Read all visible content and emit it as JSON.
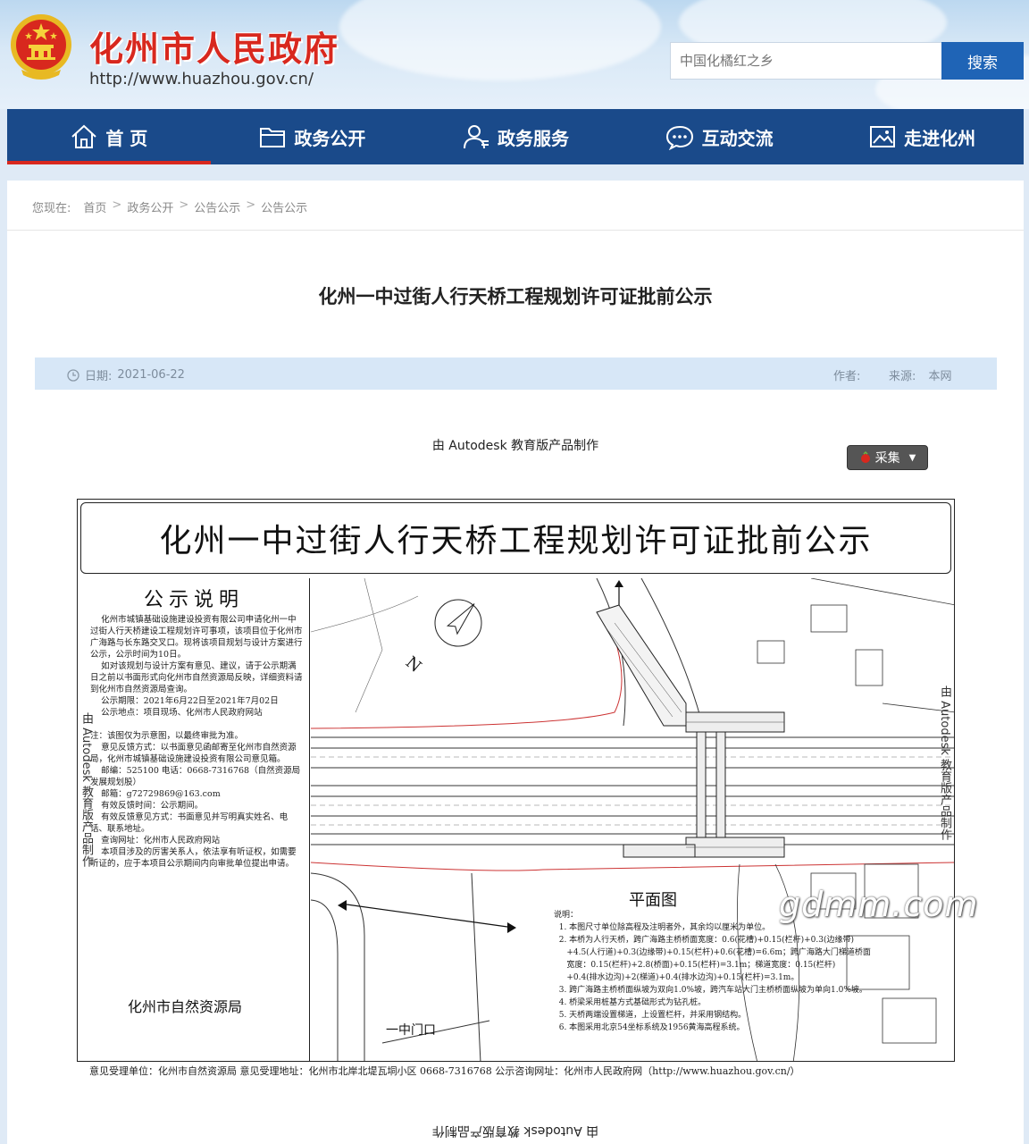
{
  "header": {
    "site_name": "化州市人民政府",
    "site_url": "http://www.huazhou.gov.cn/",
    "search_placeholder": "中国化橘红之乡",
    "search_button": "搜索"
  },
  "nav": {
    "items": [
      {
        "label": "首 页",
        "icon": "home-icon",
        "active": true
      },
      {
        "label": "政务公开",
        "icon": "folder-icon"
      },
      {
        "label": "政务服务",
        "icon": "user-service-icon"
      },
      {
        "label": "互动交流",
        "icon": "chat-icon"
      },
      {
        "label": "走进化州",
        "icon": "picture-icon"
      }
    ]
  },
  "breadcrumb": {
    "prefix": "您现在:",
    "items": [
      "首页",
      "政务公开",
      "公告公示",
      "公告公示"
    ]
  },
  "article": {
    "title": "化州一中过街人行天桥工程规划许可证批前公示",
    "date_label": "日期:",
    "date": "2021-06-22",
    "author_label": "作者:",
    "source_label": "来源:",
    "source": "本网",
    "autodesk_note": "由 Autodesk 教育版产品制作",
    "collect_button": "采集"
  },
  "drawing": {
    "title": "化州一中过街人行天桥工程规划许可证批前公示",
    "notice_heading": "公示说明",
    "notice_text": "    化州市城镇基础设施建设投资有限公司申请化州一中过街人行天桥建设工程规划许可事项，该项目位于化州市广海路与长东路交叉口。现将该项目规划与设计方案进行公示，公示时间为10日。\n    如对该规划与设计方案有意见、建议，请于公示期满日之前以书面形式向化州市自然资源局反映，详细资料请到化州市自然资源局查询。\n    公示期限：2021年6月22日至2021年7月02日\n    公示地点：项目现场、化州市人民政府网站\n\n注：该图仅为示意图，以最终审批为准。\n    意见反馈方式：以书面意见函邮寄至化州市自然资源局，化州市城镇基础设施建设投资有限公司意见箱。\n    邮编：525100 电话：0668-7316768（自然资源局发展规划股）\n    邮箱：g72729869@163.com\n    有效反馈时间：公示期间。\n    有效反馈意见方式：书面意见并写明真实姓名、电话、联系地址。\n    查询网址：化州市人民政府网站\n    本项目涉及的厉害关系人，依法享有听证权，如需要听证的，应于本项目公示期间内向审批单位提出申请。",
    "notice_sign": "化州市自然资源局",
    "plan_label": "平面图",
    "plan_notes": "说明：\n  1. 本图尺寸单位除高程及注明者外，其余均以厘米为单位。\n  2. 本桥为人行天桥，跨广海路主桥桥面宽度：0.6(花槽)+0.15(栏杆)+0.3(边缘带)\n     +4.5(人行道)+0.3(边缘带)+0.15(栏杆)+0.6(花槽)=6.6m；跨广海路大门梯道桥面\n     宽度：0.15(栏杆)+2.8(桥面)+0.15(栏杆)=3.1m；梯道宽度：0.15(栏杆)\n     +0.4(排水边沟)+2(梯道)+0.4(排水边沟)+0.15(栏杆)=3.1m。\n  3. 跨广海路主桥桥面纵坡为双向1.0%坡，跨汽车站大门主桥桥面纵坡为单向1.0%坡。\n  4. 桥梁采用桩基方式基础形式为钻孔桩。\n  5. 天桥两端设置梯道，上设置栏杆，并采用钢结构。\n  6. 本图采用北京54坐标系统及1956黄海高程系统。",
    "road_label": "一中门口",
    "watermark": "由 Autodesk 教育版产品制作",
    "footer": "意见受理单位：化州市自然资源局    意见受理地址：化州市北岸北堤瓦垌小区    0668-7316768    公示咨询网址：化州市人民政府网（http://www.huazhou.gov.cn/）"
  },
  "site_watermark": "gdmm.com",
  "colors": {
    "nav_bg": "#1a4a8a",
    "brand_red": "#d8281e",
    "search_btn": "#1f64b6",
    "meta_bar": "#d7e7f7"
  }
}
